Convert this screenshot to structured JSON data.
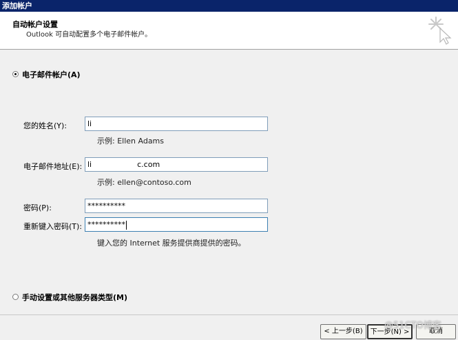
{
  "window": {
    "title": "添加帐户"
  },
  "header": {
    "title": "自动帐户设置",
    "subtitle": "Outlook 可自动配置多个电子邮件帐户。"
  },
  "email_option": {
    "label": "电子邮件帐户(A)",
    "selected": true
  },
  "form": {
    "name": {
      "label": "您的姓名(Y):",
      "value": "li",
      "hint": "示例: Ellen Adams"
    },
    "email": {
      "label": "电子邮件地址(E):",
      "value_prefix": "li",
      "value_suffix": "c.com",
      "hint": "示例: ellen@contoso.com"
    },
    "password": {
      "label": "密码(P):",
      "value": "**********"
    },
    "retype_password": {
      "label": "重新键入密码(T):",
      "value": "**********"
    },
    "password_hint": "键入您的 Internet 服务提供商提供的密码。"
  },
  "manual_option": {
    "label": "手动设置或其他服务器类型(M)",
    "selected": false
  },
  "buttons": {
    "back": "< 上一步(B)",
    "next": "下一步(N) >",
    "cancel": "取消"
  },
  "watermark": "@51CTO博客"
}
